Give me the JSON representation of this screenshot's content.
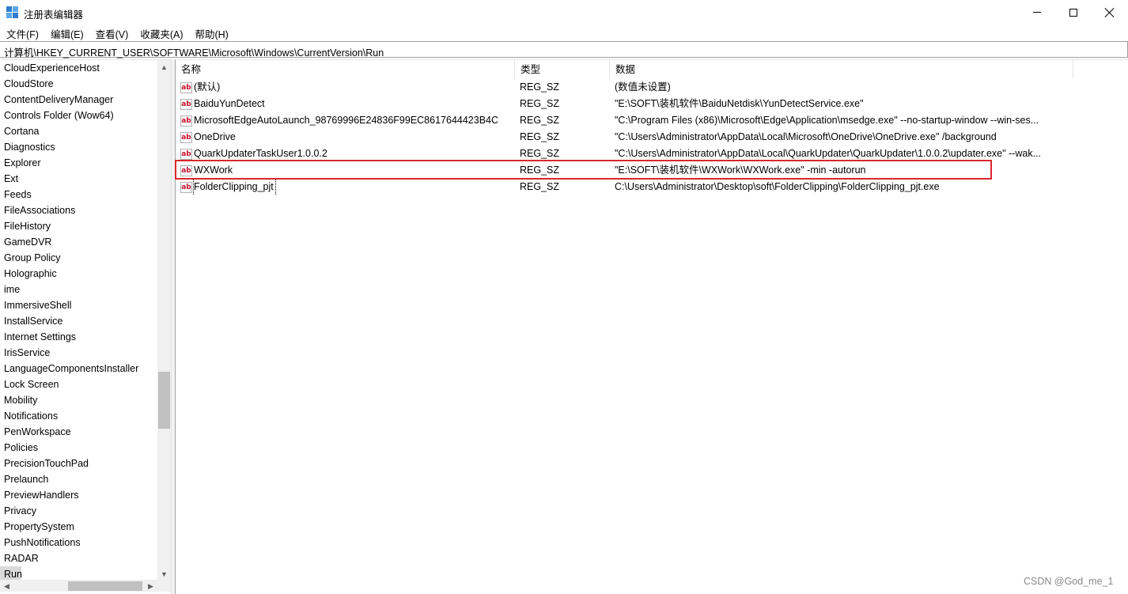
{
  "window": {
    "title": "注册表编辑器",
    "icon": "registry-icon",
    "controls": {
      "minimize": "minimize-icon",
      "maximize": "maximize-icon",
      "close": "close-icon"
    }
  },
  "menu": {
    "items": [
      {
        "label": "文件(F)"
      },
      {
        "label": "编辑(E)"
      },
      {
        "label": "查看(V)"
      },
      {
        "label": "收藏夹(A)"
      },
      {
        "label": "帮助(H)"
      }
    ]
  },
  "address": {
    "path": "计算机\\HKEY_CURRENT_USER\\SOFTWARE\\Microsoft\\Windows\\CurrentVersion\\Run"
  },
  "tree": {
    "items": [
      {
        "label": "CloudExperienceHost"
      },
      {
        "label": "CloudStore"
      },
      {
        "label": "ContentDeliveryManager"
      },
      {
        "label": "Controls Folder (Wow64)"
      },
      {
        "label": "Cortana"
      },
      {
        "label": "Diagnostics"
      },
      {
        "label": "Explorer"
      },
      {
        "label": "Ext"
      },
      {
        "label": "Feeds"
      },
      {
        "label": "FileAssociations"
      },
      {
        "label": "FileHistory"
      },
      {
        "label": "GameDVR"
      },
      {
        "label": "Group Policy"
      },
      {
        "label": "Holographic"
      },
      {
        "label": "ime"
      },
      {
        "label": "ImmersiveShell"
      },
      {
        "label": "InstallService"
      },
      {
        "label": "Internet Settings"
      },
      {
        "label": "IrisService"
      },
      {
        "label": "LanguageComponentsInstaller"
      },
      {
        "label": "Lock Screen"
      },
      {
        "label": "Mobility"
      },
      {
        "label": "Notifications"
      },
      {
        "label": "PenWorkspace"
      },
      {
        "label": "Policies"
      },
      {
        "label": "PrecisionTouchPad"
      },
      {
        "label": "Prelaunch"
      },
      {
        "label": "PreviewHandlers"
      },
      {
        "label": "Privacy"
      },
      {
        "label": "PropertySystem"
      },
      {
        "label": "PushNotifications"
      },
      {
        "label": "RADAR"
      },
      {
        "label": "Run"
      }
    ],
    "selected": "Run"
  },
  "list": {
    "columns": {
      "name": "名称",
      "type": "类型",
      "data": "数据"
    },
    "value_icon": "string-value-icon",
    "value_icon_text": "ab",
    "rows": [
      {
        "name": "(默认)",
        "type": "REG_SZ",
        "data": "(数值未设置)"
      },
      {
        "name": "BaiduYunDetect",
        "type": "REG_SZ",
        "data": "\"E:\\SOFT\\装机软件\\BaiduNetdisk\\YunDetectService.exe\""
      },
      {
        "name": "MicrosoftEdgeAutoLaunch_98769996E24836F99EC8617644423B4C",
        "type": "REG_SZ",
        "data": "\"C:\\Program Files (x86)\\Microsoft\\Edge\\Application\\msedge.exe\" --no-startup-window --win-ses..."
      },
      {
        "name": "OneDrive",
        "type": "REG_SZ",
        "data": "\"C:\\Users\\Administrator\\AppData\\Local\\Microsoft\\OneDrive\\OneDrive.exe\" /background"
      },
      {
        "name": "QuarkUpdaterTaskUser1.0.0.2",
        "type": "REG_SZ",
        "data": "\"C:\\Users\\Administrator\\AppData\\Local\\QuarkUpdater\\QuarkUpdater\\1.0.0.2\\updater.exe\" --wak..."
      },
      {
        "name": "WXWork",
        "type": "REG_SZ",
        "data": "\"E:\\SOFT\\装机软件\\WXWork\\WXWork.exe\" -min -autorun"
      },
      {
        "name": "FolderClipping_pjt",
        "type": "REG_SZ",
        "data": "C:\\Users\\Administrator\\Desktop\\soft\\FolderClipping\\FolderClipping_pjt.exe"
      }
    ],
    "highlight_color": "#d9272e"
  },
  "watermark": "CSDN @God_me_1"
}
